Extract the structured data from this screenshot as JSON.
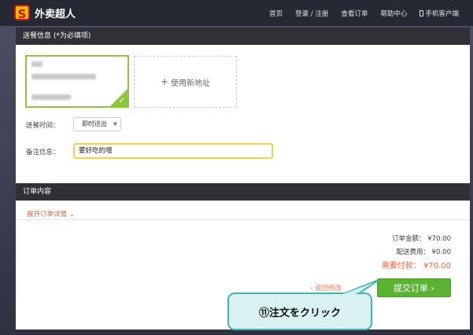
{
  "header": {
    "logo_glyph": "S",
    "brand": "外卖超人",
    "nav": [
      "首页",
      "登录 / 注册",
      "查看订单",
      "帮助中心"
    ],
    "mobile_client": "手机客户端"
  },
  "delivery": {
    "section_title": "送餐信息 (*为必填项)",
    "add_address": "使用新地址",
    "time_label": "送餐时间：",
    "time_value": "即时送出",
    "note_label": "备注信息：",
    "note_value": "要好吃的哦"
  },
  "order": {
    "section_title": "订单内容",
    "expand_details": "展开订单详情",
    "total_label": "订单金额：",
    "total_value": "¥70.00",
    "delivery_fee_label": "配送费用：",
    "delivery_fee_value": "¥0.00",
    "pay_label": "需要付款：",
    "pay_value": "¥70.00",
    "back_link": "返回修改",
    "submit": "提交订单"
  },
  "annotation": {
    "text": "⑪注文をクリック"
  },
  "colors": {
    "accent_green": "#5bb332",
    "accent_orange": "#e2663b",
    "note_border": "#f2d04a",
    "callout_bg": "#d9f2f1",
    "callout_border": "#3fb7ae"
  }
}
